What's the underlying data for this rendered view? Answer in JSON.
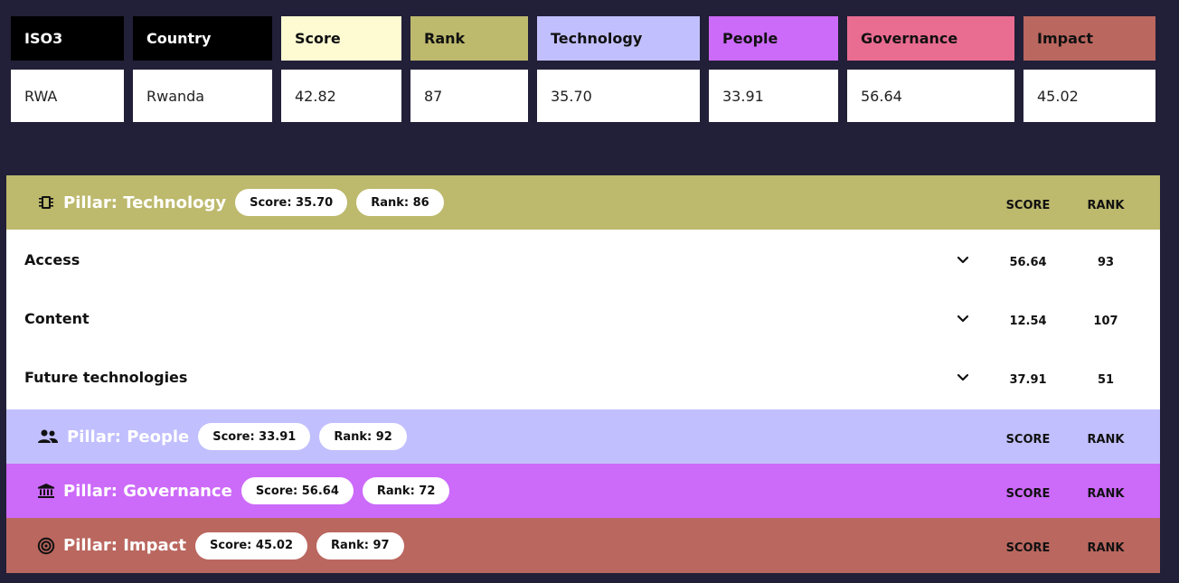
{
  "summary_table": {
    "columns": [
      {
        "key": "iso3",
        "label": "ISO3",
        "value": "RWA",
        "bg": "#000000",
        "fg": "#ffffff"
      },
      {
        "key": "country",
        "label": "Country",
        "value": "Rwanda",
        "bg": "#000000",
        "fg": "#ffffff"
      },
      {
        "key": "score",
        "label": "Score",
        "value": "42.82",
        "bg": "#fefbd3",
        "fg": "#111111"
      },
      {
        "key": "rank",
        "label": "Rank",
        "value": "87",
        "bg": "#bdb96d",
        "fg": "#111111"
      },
      {
        "key": "technology",
        "label": "Technology",
        "value": "35.70",
        "bg": "#c1bffe",
        "fg": "#111111"
      },
      {
        "key": "people",
        "label": "People",
        "value": "33.91",
        "bg": "#cc6afa",
        "fg": "#111111"
      },
      {
        "key": "governance",
        "label": "Governance",
        "value": "56.64",
        "bg": "#e96c91",
        "fg": "#111111"
      },
      {
        "key": "impact",
        "label": "Impact",
        "value": "45.02",
        "bg": "#ba675f",
        "fg": "#111111"
      }
    ]
  },
  "pillars": [
    {
      "key": "technology",
      "title": "Pillar: Technology",
      "score_pill": "Score: 35.70",
      "rank_pill": "Rank: 86",
      "score_header": "SCORE",
      "rank_header": "RANK",
      "bg": "#bdb96d",
      "icon": "chip-icon",
      "subpillars": [
        {
          "name": "Access",
          "score": "56.64",
          "rank": "93"
        },
        {
          "name": "Content",
          "score": "12.54",
          "rank": "107"
        },
        {
          "name": "Future technologies",
          "score": "37.91",
          "rank": "51"
        }
      ]
    },
    {
      "key": "people",
      "title": "Pillar: People",
      "score_pill": "Score: 33.91",
      "rank_pill": "Rank: 92",
      "score_header": "SCORE",
      "rank_header": "RANK",
      "bg": "#c1bffe",
      "icon": "people-icon",
      "subpillars": []
    },
    {
      "key": "governance",
      "title": "Pillar: Governance",
      "score_pill": "Score: 56.64",
      "rank_pill": "Rank: 72",
      "score_header": "SCORE",
      "rank_header": "RANK",
      "bg": "#cc6afa",
      "icon": "institution-icon",
      "subpillars": []
    },
    {
      "key": "impact",
      "title": "Pillar: Impact",
      "score_pill": "Score: 45.02",
      "rank_pill": "Rank: 97",
      "score_header": "SCORE",
      "rank_header": "RANK",
      "bg": "#ba675f",
      "icon": "target-icon",
      "subpillars": []
    }
  ],
  "colors": {
    "page_background": "#221f38",
    "panel_background": "#ffffff"
  }
}
